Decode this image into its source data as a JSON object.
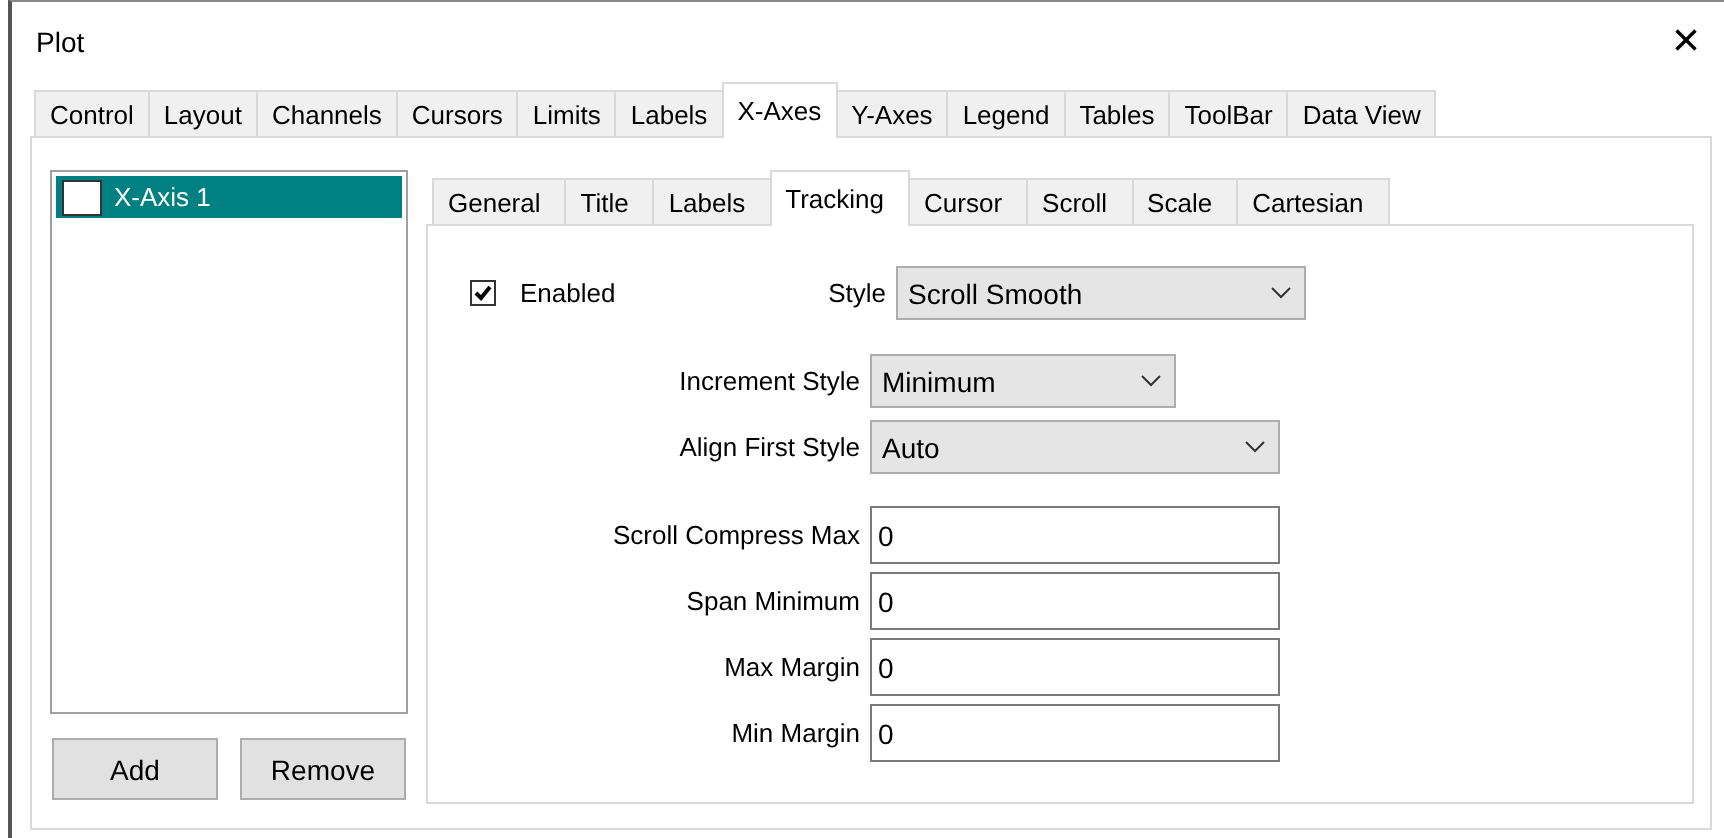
{
  "window": {
    "title": "Plot",
    "close": "×"
  },
  "tabs": [
    {
      "label": "Control",
      "selected": false
    },
    {
      "label": "Layout",
      "selected": false
    },
    {
      "label": "Channels",
      "selected": false
    },
    {
      "label": "Cursors",
      "selected": false
    },
    {
      "label": "Limits",
      "selected": false
    },
    {
      "label": "Labels",
      "selected": false
    },
    {
      "label": "X-Axes",
      "selected": true
    },
    {
      "label": "Y-Axes",
      "selected": false
    },
    {
      "label": "Legend",
      "selected": false
    },
    {
      "label": "Tables",
      "selected": false
    },
    {
      "label": "ToolBar",
      "selected": false
    },
    {
      "label": "Data View",
      "selected": false
    }
  ],
  "axis_list": {
    "items": [
      {
        "label": "X-Axis 1",
        "selected": true,
        "checked": false
      }
    ],
    "buttons": [
      "Add",
      "Remove"
    ]
  },
  "subtabs": [
    {
      "label": "General",
      "selected": false
    },
    {
      "label": "Title",
      "selected": false
    },
    {
      "label": "Labels",
      "selected": false
    },
    {
      "label": "Tracking",
      "selected": true
    },
    {
      "label": "Cursor",
      "selected": false
    },
    {
      "label": "Scroll",
      "selected": false
    },
    {
      "label": "Scale",
      "selected": false
    },
    {
      "label": "Cartesian",
      "selected": false
    }
  ],
  "tracking": {
    "enabled": {
      "label": "Enabled",
      "checked": true
    },
    "style": {
      "label": "Style",
      "value": "Scroll Smooth"
    },
    "combos": [
      {
        "label": "Increment Style",
        "value": "Minimum",
        "kind": "narrow"
      },
      {
        "label": "Align First Style",
        "value": "Auto",
        "kind": "wide"
      }
    ],
    "fields": [
      {
        "label": "Scroll Compress Max",
        "value": "0"
      },
      {
        "label": "Span Minimum",
        "value": "0"
      },
      {
        "label": "Max Margin",
        "value": "0"
      },
      {
        "label": "Min Margin",
        "value": "0"
      }
    ]
  }
}
